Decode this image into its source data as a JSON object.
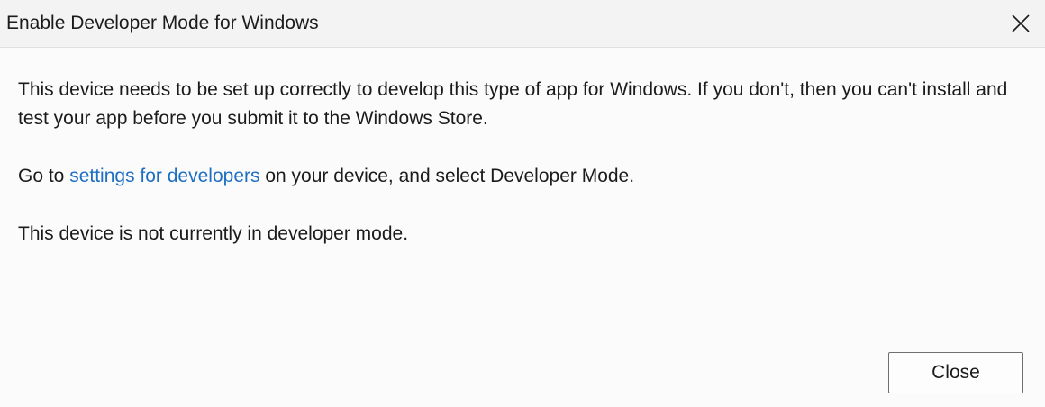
{
  "window": {
    "title": "Enable Developer Mode for Windows",
    "close_icon": "close-icon"
  },
  "content": {
    "paragraph1": "This device needs to be set up correctly to develop this type of app for Windows. If you don't, then you can't install and test your app before you submit it to the Windows Store.",
    "paragraph2": {
      "prefix": "Go to ",
      "link": "settings for developers",
      "suffix": " on your device, and select Developer Mode."
    },
    "paragraph3": "This device is not currently in developer mode."
  },
  "footer": {
    "close_label": "Close"
  },
  "colors": {
    "link": "#1e6fc2",
    "titlebar_bg": "#f3f3f3",
    "body_bg": "#fbfbfb"
  }
}
